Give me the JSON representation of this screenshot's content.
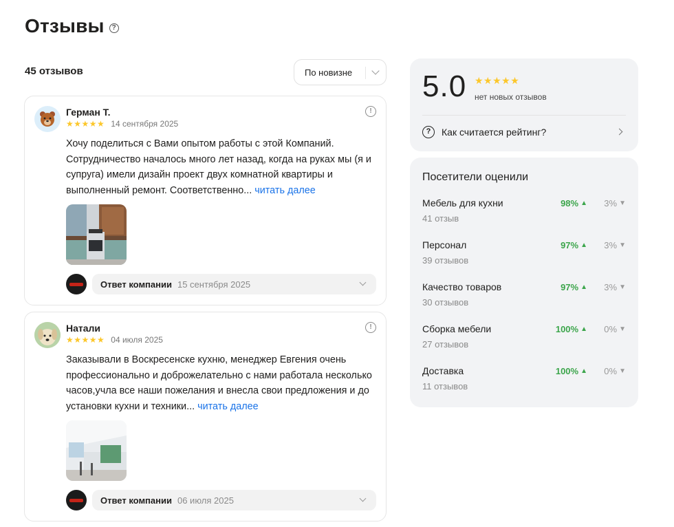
{
  "page": {
    "title": "Отзывы",
    "help_glyph": "?"
  },
  "reviews": {
    "count_label": "45 отзывов",
    "sort": {
      "selected": "По новизне"
    },
    "items": [
      {
        "author": "Герман Т.",
        "stars": "★★★★★",
        "date": "14 сентября 2025",
        "text": "Хочу поделиться с Вами опытом работы с этой Компаний. Сотрудничество началось много лет назад, когда на руках мы (я и супруга) имели дизайн проект двух комнатной квартиры и выполненный ремонт. Соответственно...",
        "read_more": "читать далее",
        "avatar_icon": "bear-avatar",
        "company_answer": {
          "label": "Ответ компании",
          "date": "15 сентября 2025"
        }
      },
      {
        "author": "Натали",
        "stars": "★★★★★",
        "date": "04 июля 2025",
        "text": "Заказывали в Воскресенске кухню, менеджер Евгения очень профессионально и доброжелательно с нами работала несколько часов,учла все наши пожелания и внесла свои предложения и до установки кухни и техники...",
        "read_more": "читать далее",
        "avatar_icon": "dog-avatar",
        "company_answer": {
          "label": "Ответ компании",
          "date": "06 июля 2025"
        }
      }
    ]
  },
  "rating": {
    "value": "5.0",
    "stars": "★★★★★",
    "note": "нет новых отзывов",
    "how_label": "Как считается рейтинг?"
  },
  "aspects": {
    "title": "Посетители оценили",
    "items": [
      {
        "name": "Мебель для кухни",
        "count": "41 отзыв",
        "positive": "98%",
        "negative": "3%"
      },
      {
        "name": "Персонал",
        "count": "39 отзывов",
        "positive": "97%",
        "negative": "3%"
      },
      {
        "name": "Качество товаров",
        "count": "30 отзывов",
        "positive": "97%",
        "negative": "3%"
      },
      {
        "name": "Сборка мебели",
        "count": "27 отзывов",
        "positive": "100%",
        "negative": "0%"
      },
      {
        "name": "Доставка",
        "count": "11 отзывов",
        "positive": "100%",
        "negative": "0%"
      }
    ]
  },
  "colors": {
    "star": "#fcc72b",
    "link": "#1a73e8",
    "positive": "#3ca54b",
    "panel_bg": "#f2f3f5"
  }
}
